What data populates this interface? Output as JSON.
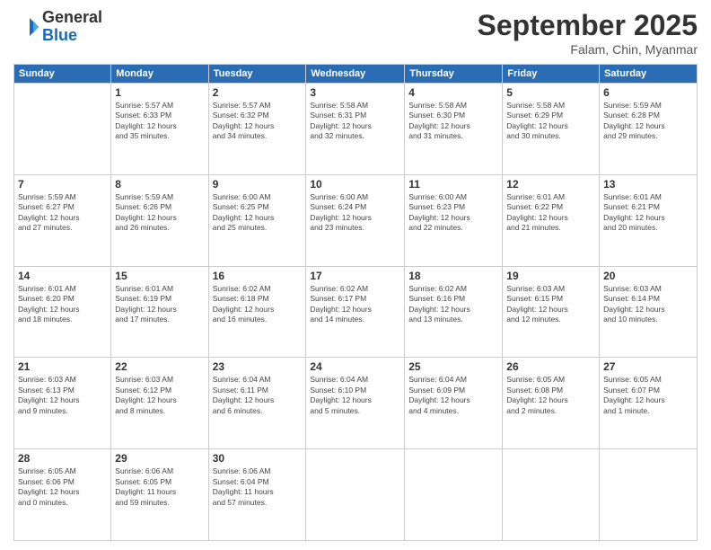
{
  "header": {
    "logo_general": "General",
    "logo_blue": "Blue",
    "month": "September 2025",
    "location": "Falam, Chin, Myanmar"
  },
  "days_of_week": [
    "Sunday",
    "Monday",
    "Tuesday",
    "Wednesday",
    "Thursday",
    "Friday",
    "Saturday"
  ],
  "weeks": [
    [
      {
        "day": "",
        "info": ""
      },
      {
        "day": "1",
        "info": "Sunrise: 5:57 AM\nSunset: 6:33 PM\nDaylight: 12 hours\nand 35 minutes."
      },
      {
        "day": "2",
        "info": "Sunrise: 5:57 AM\nSunset: 6:32 PM\nDaylight: 12 hours\nand 34 minutes."
      },
      {
        "day": "3",
        "info": "Sunrise: 5:58 AM\nSunset: 6:31 PM\nDaylight: 12 hours\nand 32 minutes."
      },
      {
        "day": "4",
        "info": "Sunrise: 5:58 AM\nSunset: 6:30 PM\nDaylight: 12 hours\nand 31 minutes."
      },
      {
        "day": "5",
        "info": "Sunrise: 5:58 AM\nSunset: 6:29 PM\nDaylight: 12 hours\nand 30 minutes."
      },
      {
        "day": "6",
        "info": "Sunrise: 5:59 AM\nSunset: 6:28 PM\nDaylight: 12 hours\nand 29 minutes."
      }
    ],
    [
      {
        "day": "7",
        "info": "Sunrise: 5:59 AM\nSunset: 6:27 PM\nDaylight: 12 hours\nand 27 minutes."
      },
      {
        "day": "8",
        "info": "Sunrise: 5:59 AM\nSunset: 6:26 PM\nDaylight: 12 hours\nand 26 minutes."
      },
      {
        "day": "9",
        "info": "Sunrise: 6:00 AM\nSunset: 6:25 PM\nDaylight: 12 hours\nand 25 minutes."
      },
      {
        "day": "10",
        "info": "Sunrise: 6:00 AM\nSunset: 6:24 PM\nDaylight: 12 hours\nand 23 minutes."
      },
      {
        "day": "11",
        "info": "Sunrise: 6:00 AM\nSunset: 6:23 PM\nDaylight: 12 hours\nand 22 minutes."
      },
      {
        "day": "12",
        "info": "Sunrise: 6:01 AM\nSunset: 6:22 PM\nDaylight: 12 hours\nand 21 minutes."
      },
      {
        "day": "13",
        "info": "Sunrise: 6:01 AM\nSunset: 6:21 PM\nDaylight: 12 hours\nand 20 minutes."
      }
    ],
    [
      {
        "day": "14",
        "info": "Sunrise: 6:01 AM\nSunset: 6:20 PM\nDaylight: 12 hours\nand 18 minutes."
      },
      {
        "day": "15",
        "info": "Sunrise: 6:01 AM\nSunset: 6:19 PM\nDaylight: 12 hours\nand 17 minutes."
      },
      {
        "day": "16",
        "info": "Sunrise: 6:02 AM\nSunset: 6:18 PM\nDaylight: 12 hours\nand 16 minutes."
      },
      {
        "day": "17",
        "info": "Sunrise: 6:02 AM\nSunset: 6:17 PM\nDaylight: 12 hours\nand 14 minutes."
      },
      {
        "day": "18",
        "info": "Sunrise: 6:02 AM\nSunset: 6:16 PM\nDaylight: 12 hours\nand 13 minutes."
      },
      {
        "day": "19",
        "info": "Sunrise: 6:03 AM\nSunset: 6:15 PM\nDaylight: 12 hours\nand 12 minutes."
      },
      {
        "day": "20",
        "info": "Sunrise: 6:03 AM\nSunset: 6:14 PM\nDaylight: 12 hours\nand 10 minutes."
      }
    ],
    [
      {
        "day": "21",
        "info": "Sunrise: 6:03 AM\nSunset: 6:13 PM\nDaylight: 12 hours\nand 9 minutes."
      },
      {
        "day": "22",
        "info": "Sunrise: 6:03 AM\nSunset: 6:12 PM\nDaylight: 12 hours\nand 8 minutes."
      },
      {
        "day": "23",
        "info": "Sunrise: 6:04 AM\nSunset: 6:11 PM\nDaylight: 12 hours\nand 6 minutes."
      },
      {
        "day": "24",
        "info": "Sunrise: 6:04 AM\nSunset: 6:10 PM\nDaylight: 12 hours\nand 5 minutes."
      },
      {
        "day": "25",
        "info": "Sunrise: 6:04 AM\nSunset: 6:09 PM\nDaylight: 12 hours\nand 4 minutes."
      },
      {
        "day": "26",
        "info": "Sunrise: 6:05 AM\nSunset: 6:08 PM\nDaylight: 12 hours\nand 2 minutes."
      },
      {
        "day": "27",
        "info": "Sunrise: 6:05 AM\nSunset: 6:07 PM\nDaylight: 12 hours\nand 1 minute."
      }
    ],
    [
      {
        "day": "28",
        "info": "Sunrise: 6:05 AM\nSunset: 6:06 PM\nDaylight: 12 hours\nand 0 minutes."
      },
      {
        "day": "29",
        "info": "Sunrise: 6:06 AM\nSunset: 6:05 PM\nDaylight: 11 hours\nand 59 minutes."
      },
      {
        "day": "30",
        "info": "Sunrise: 6:06 AM\nSunset: 6:04 PM\nDaylight: 11 hours\nand 57 minutes."
      },
      {
        "day": "",
        "info": ""
      },
      {
        "day": "",
        "info": ""
      },
      {
        "day": "",
        "info": ""
      },
      {
        "day": "",
        "info": ""
      }
    ]
  ]
}
